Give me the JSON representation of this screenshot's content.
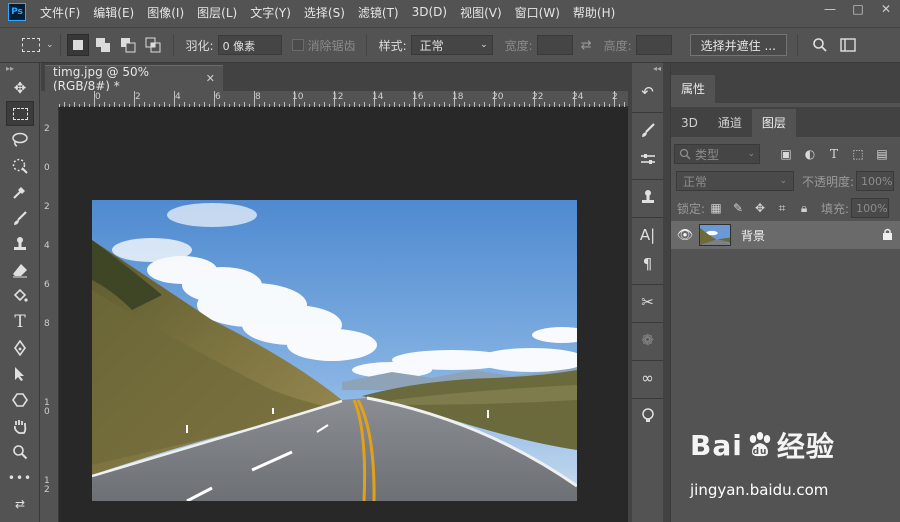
{
  "app": {
    "logo_text": "Ps"
  },
  "menu": [
    "文件(F)",
    "编辑(E)",
    "图像(I)",
    "图层(L)",
    "文字(Y)",
    "选择(S)",
    "滤镜(T)",
    "3D(D)",
    "视图(V)",
    "窗口(W)",
    "帮助(H)"
  ],
  "window_controls": [
    "—",
    "□",
    "✕"
  ],
  "options_bar": {
    "feather_label": "羽化:",
    "feather_value": "0 像素",
    "antialias_label": "消除锯齿",
    "style_label": "样式:",
    "style_value": "正常",
    "width_label": "宽度:",
    "height_label": "高度:",
    "select_mask_label": "选择并遮住 ..."
  },
  "document": {
    "tab_title": "timg.jpg @ 50%(RGB/8#) *",
    "close": "✕"
  },
  "ruler": {
    "top_labels": [
      "0",
      "2",
      "4",
      "6",
      "8",
      "10",
      "12",
      "14",
      "16",
      "18",
      "20",
      "22",
      "24",
      "2"
    ],
    "left_labels": [
      "2",
      "0",
      "2",
      "4",
      "6",
      "8",
      "1 0",
      "1 2"
    ]
  },
  "properties_panel": {
    "title": "属性"
  },
  "layers_panel": {
    "tabs": [
      "3D",
      "通道",
      "图层"
    ],
    "active_tab": "图层",
    "filter_label": "类型",
    "blend_mode": "正常",
    "opacity_label": "不透明度:",
    "opacity_value": "100%",
    "lock_label": "锁定:",
    "fill_label": "填充:",
    "fill_value": "100%",
    "layers": [
      {
        "name": "背景",
        "visible": true,
        "locked": true
      }
    ]
  },
  "watermark": {
    "brand_left": "Bai",
    "brand_right": "经验",
    "url": "jingyan.baidu.com"
  },
  "colors": {
    "accent": "#31a8ff",
    "panel": "#535353",
    "canvas_bg": "#282828"
  }
}
